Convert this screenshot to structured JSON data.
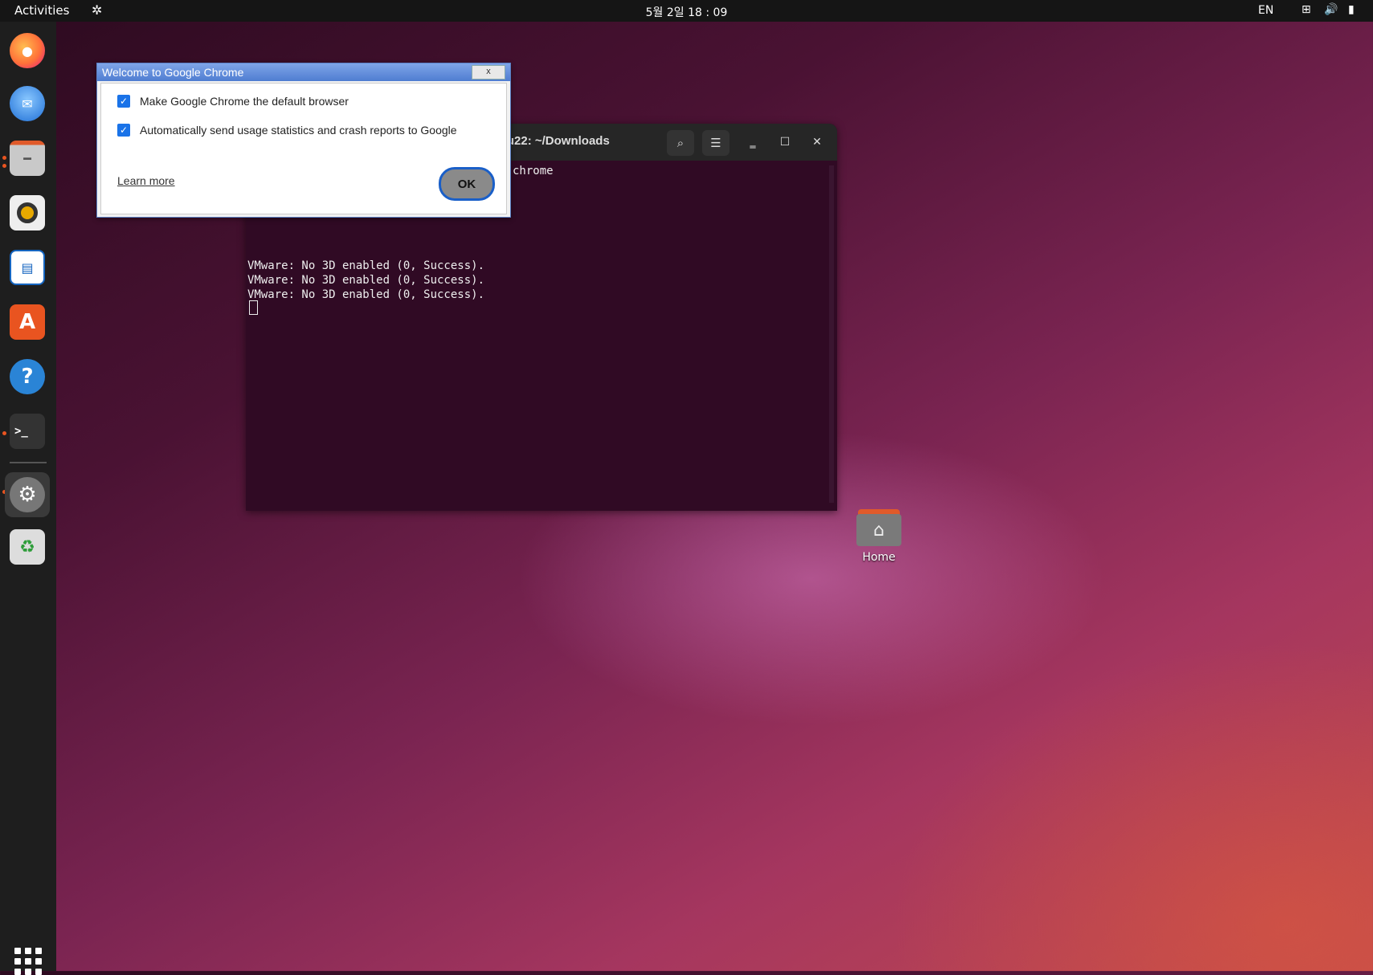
{
  "topbar": {
    "activities": "Activities",
    "clock": "5월 2일  18 : 09",
    "lang": "EN"
  },
  "dock": {
    "items": [
      "firefox",
      "thunderbird",
      "files",
      "rhythmbox",
      "libreoffice-writer",
      "ubuntu-software",
      "help",
      "terminal",
      "settings",
      "trash"
    ],
    "show_apps": "show-applications"
  },
  "terminal": {
    "title": "ubuntu22: ~/Downloads",
    "lines": [
      "chrome",
      "VMware: No 3D enabled (0, Success).",
      "VMware: No 3D enabled (0, Success).",
      "VMware: No 3D enabled (0, Success)."
    ]
  },
  "dialog": {
    "title": "Welcome to Google Chrome",
    "close": "x",
    "default_browser": "Make Google Chrome the default browser",
    "usage_stats": "Automatically send usage statistics and crash reports to Google",
    "learn_more": "Learn more",
    "ok": "OK"
  },
  "desktop": {
    "home_label": "Home"
  },
  "colors": {
    "accent": "#e95420",
    "terminal_bg": "#300a24",
    "dialog_title": "#4f7dd1",
    "checkbox": "#1a73e8"
  }
}
